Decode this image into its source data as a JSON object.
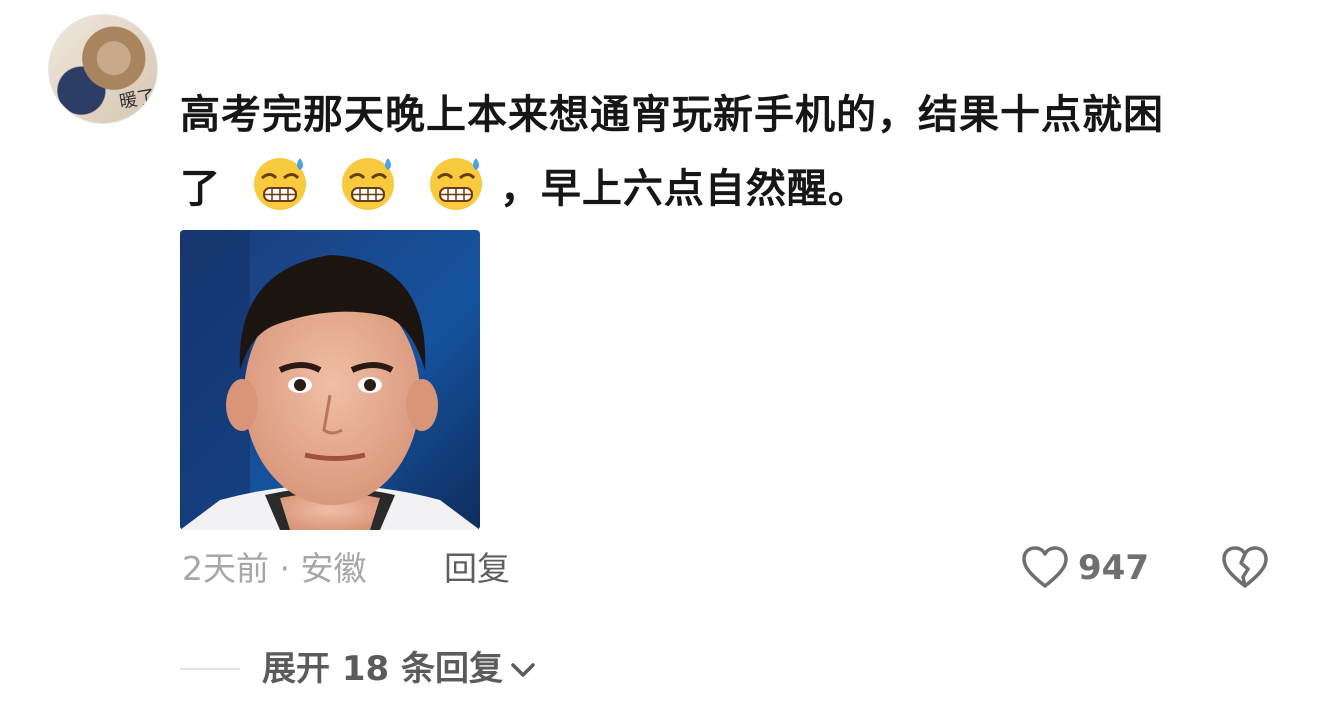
{
  "comment": {
    "username": "",
    "text_line1": "高考完那天晚上本来想通宵玩新手机的，结果十点就困",
    "text_line2_prefix": "了",
    "text_line2_suffix": "，早上六点自然醒。",
    "emoji_name": "grimacing-sweat-face-emoji",
    "emoji_count": 3,
    "time_location": "2天前 · 安徽",
    "reply_label": "回复",
    "like_count": "947",
    "expand_label": "展开 18 条回复"
  },
  "avatar": {
    "glyph": "暖了"
  },
  "colors": {
    "text": "#161616",
    "meta": "#a7a7a7",
    "reply": "#5f5f5f",
    "icon": "#6f6f6f"
  }
}
